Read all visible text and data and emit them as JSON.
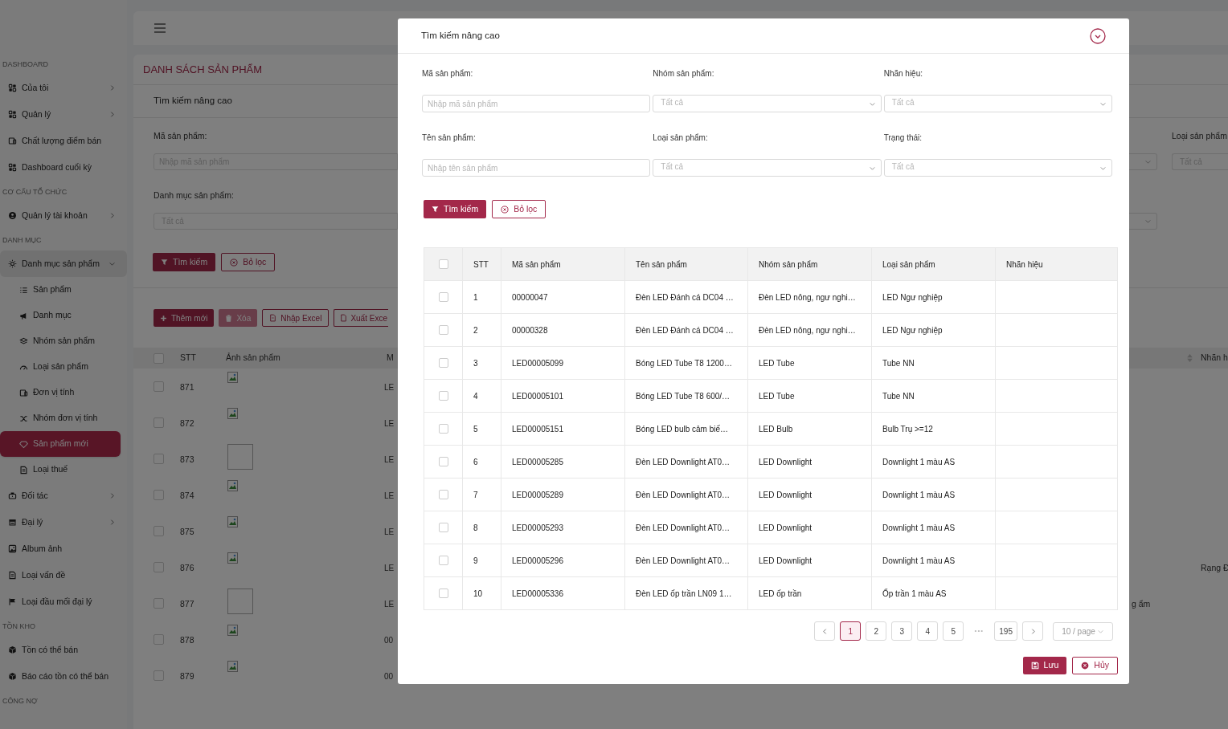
{
  "sidebar": {
    "sections": [
      {
        "title": "DASHBOARD",
        "items": [
          {
            "label": "Của tôi",
            "has_submenu": true,
            "expanded": false,
            "selected": false
          },
          {
            "label": "Quản lý",
            "has_submenu": true,
            "expanded": false,
            "selected": false
          },
          {
            "label": "Chất lượng điểm bán",
            "has_submenu": false,
            "expanded": false,
            "selected": false
          },
          {
            "label": "Dashboard cuối kỳ",
            "has_submenu": false,
            "expanded": false,
            "selected": false
          }
        ]
      },
      {
        "title": "CƠ CẤU TỔ CHỨC",
        "items": [
          {
            "label": "Quản lý tài khoản",
            "has_submenu": true,
            "expanded": false,
            "selected": false
          }
        ]
      },
      {
        "title": "DANH MỤC",
        "items": [
          {
            "label": "Danh mục sản phẩm",
            "has_submenu": true,
            "expanded": true,
            "selected": false,
            "children": [
              {
                "label": "Sản phẩm",
                "selected": false
              },
              {
                "label": "Danh mục",
                "selected": false
              },
              {
                "label": "Nhóm sản phẩm",
                "selected": false
              },
              {
                "label": "Loại sản phẩm",
                "selected": false
              },
              {
                "label": "Đơn vị tính",
                "selected": false
              },
              {
                "label": "Nhóm đơn vị tính",
                "selected": false
              },
              {
                "label": "Sản phẩm mới",
                "selected": true
              },
              {
                "label": "Loại thuế",
                "selected": false
              }
            ]
          },
          {
            "label": "Đối tác",
            "has_submenu": true,
            "expanded": false,
            "selected": false
          },
          {
            "label": "Đại lý",
            "has_submenu": true,
            "expanded": false,
            "selected": false
          },
          {
            "label": "Album ảnh",
            "has_submenu": false,
            "expanded": false,
            "selected": false
          },
          {
            "label": "Loại vấn đề",
            "has_submenu": false,
            "expanded": false,
            "selected": false
          },
          {
            "label": "Loại đầu mối đại lý",
            "has_submenu": false,
            "expanded": false,
            "selected": false
          }
        ]
      },
      {
        "title": "TỒN KHO",
        "items": [
          {
            "label": "Tồn có thể bán",
            "has_submenu": false,
            "expanded": false,
            "selected": false
          },
          {
            "label": "Báo cáo tồn có thể bán",
            "has_submenu": false,
            "expanded": false,
            "selected": false
          }
        ]
      },
      {
        "title": "CÔNG NỢ"
      }
    ]
  },
  "page": {
    "title": "DANH SÁCH SẢN PHẨM",
    "search_title": "Tìm kiếm nâng cao",
    "left_fields": [
      {
        "kind": "input",
        "label": "Mã sản phẩm:",
        "placeholder": "Nhập mã sản phẩm"
      },
      {
        "kind": "select",
        "label": "Danh mục sản phẩm:",
        "placeholder": "Tất cả"
      }
    ],
    "right_field": {
      "label": "Loại sản phẩm",
      "placeholder": "Tất cả"
    },
    "search_buttons": [
      {
        "label": "Tìm kiếm",
        "kind": "primary"
      },
      {
        "label": "Bỏ lọc",
        "kind": "outline"
      }
    ],
    "actions": [
      {
        "label": "Thêm mới",
        "kind": "primary",
        "disabled": false
      },
      {
        "label": "Xóa",
        "kind": "primary",
        "disabled": true
      },
      {
        "label": "Nhập Excel",
        "kind": "outline",
        "disabled": false
      },
      {
        "label": "Xuất Exce",
        "kind": "outline",
        "disabled": false
      }
    ],
    "table": {
      "all_checked": false,
      "columns": [
        "STT",
        "Ảnh sản phẩm",
        "M"
      ],
      "right_column": "Nhãn h",
      "rows": [
        {
          "checked": false,
          "stt": "871",
          "kind": "broken",
          "code": "LE"
        },
        {
          "checked": false,
          "stt": "872",
          "kind": "broken",
          "code": "LE"
        },
        {
          "checked": false,
          "stt": "873",
          "kind": "empty",
          "code": "LE"
        },
        {
          "checked": false,
          "stt": "874",
          "kind": "broken",
          "code": "LE"
        },
        {
          "checked": false,
          "stt": "875",
          "kind": "broken",
          "code": "LE"
        },
        {
          "checked": false,
          "stt": "876",
          "kind": "broken",
          "code": "LE",
          "column_right_2": "Rạng Đ"
        },
        {
          "checked": false,
          "stt": "877",
          "kind": "empty",
          "code": "LE",
          "column_right_1": "g ẩm"
        },
        {
          "checked": false,
          "stt": "878",
          "kind": "broken",
          "code": "00"
        },
        {
          "checked": false,
          "stt": "879",
          "kind": "broken",
          "code": "00"
        }
      ]
    }
  },
  "modal": {
    "title": "Tìm kiếm nâng cao",
    "fields": [
      {
        "kind": "input",
        "label": "Mã sản phẩm:",
        "placeholder": "Nhập mã sản phẩm"
      },
      {
        "kind": "select",
        "label": "Nhóm sản phẩm:",
        "placeholder": "Tất cả"
      },
      {
        "kind": "select",
        "label": "Nhãn hiệu:",
        "placeholder": "Tất cả"
      },
      {
        "kind": "input",
        "label": "Tên sản phẩm:",
        "placeholder": "Nhập tên sản phẩm"
      },
      {
        "kind": "select",
        "label": "Loại sản phẩm:",
        "placeholder": "Tất cả"
      },
      {
        "kind": "select",
        "label": "Trạng thái:",
        "placeholder": "Tất cả"
      }
    ],
    "buttons": [
      {
        "label": "Tìm kiếm",
        "kind": "primary"
      },
      {
        "label": "Bỏ lọc",
        "kind": "outline"
      }
    ],
    "table": {
      "all_checked": false,
      "columns": [
        "STT",
        "Mã sản phẩm",
        "Tên sản phẩm",
        "Nhóm sản phẩm",
        "Loại sản phẩm",
        "Nhãn hiệu"
      ],
      "rows": [
        {
          "checked": false,
          "stt": "1",
          "code": "00000047",
          "name": "Đèn LED Đánh cá DC04 …",
          "group": "Đèn LED nông, ngư nghi…",
          "type": "LED Ngư nghiệp"
        },
        {
          "checked": false,
          "stt": "2",
          "code": "00000328",
          "name": "Đèn LED Đánh cá DC04 …",
          "group": "Đèn LED nông, ngư nghi…",
          "type": "LED Ngư nghiệp"
        },
        {
          "checked": false,
          "stt": "3",
          "code": "LED00005099",
          "name": "Bóng LED Tube T8 1200…",
          "group": "LED Tube",
          "type": "Tube NN"
        },
        {
          "checked": false,
          "stt": "4",
          "code": "LED00005101",
          "name": "Bóng LED Tube T8 600/…",
          "group": "LED Tube",
          "type": "Tube NN"
        },
        {
          "checked": false,
          "stt": "5",
          "code": "LED00005151",
          "name": "Bóng LED bulb cảm biế…",
          "group": "LED Bulb",
          "type": "Bulb Trụ >=12"
        },
        {
          "checked": false,
          "stt": "6",
          "code": "LED00005285",
          "name": "Đèn LED Downlight AT0…",
          "group": "LED Downlight",
          "type": "Downlight 1 màu AS"
        },
        {
          "checked": false,
          "stt": "7",
          "code": "LED00005289",
          "name": "Đèn LED Downlight AT0…",
          "group": "LED Downlight",
          "type": "Downlight 1 màu AS"
        },
        {
          "checked": false,
          "stt": "8",
          "code": "LED00005293",
          "name": "Đèn LED Downlight AT0…",
          "group": "LED Downlight",
          "type": "Downlight 1 màu AS"
        },
        {
          "checked": false,
          "stt": "9",
          "code": "LED00005296",
          "name": "Đèn LED Downlight AT0…",
          "group": "LED Downlight",
          "type": "Downlight 1 màu AS"
        },
        {
          "checked": false,
          "stt": "10",
          "code": "LED00005336",
          "name": "Đèn LED ốp trần LN09 1…",
          "group": "LED ốp trần",
          "type": "Ốp trần 1 màu AS"
        }
      ]
    },
    "pagination": {
      "pages": [
        {
          "label": "1",
          "selected": true
        },
        {
          "label": "2",
          "selected": false
        },
        {
          "label": "3",
          "selected": false
        },
        {
          "label": "4",
          "selected": false
        },
        {
          "label": "5",
          "selected": false
        }
      ],
      "ellipsis": "•••",
      "last_page": {
        "label": "195",
        "selected": false
      },
      "page_size": "10 / page"
    },
    "footer_buttons": [
      {
        "label": "Lưu",
        "kind": "primary"
      },
      {
        "label": "Hủy",
        "kind": "outline"
      }
    ]
  }
}
